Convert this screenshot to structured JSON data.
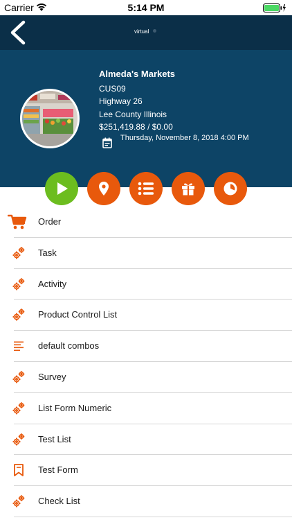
{
  "status_bar": {
    "carrier": "Carrier",
    "time": "5:14 PM"
  },
  "nav": {
    "virtual_label": "virtual"
  },
  "customer": {
    "name": "Almeda's Markets",
    "code": "CUS09",
    "address": "Highway 26",
    "region": "Lee County Illinois",
    "balance": "$251,419.88 / $0.00",
    "date": "Thursday, November 8, 2018 4:00 PM"
  },
  "actions": [
    {
      "icon": "play-icon",
      "color": "#6cbd1f"
    },
    {
      "icon": "location-pin-icon",
      "color": "#e8590c"
    },
    {
      "icon": "list-icon",
      "color": "#e8590c"
    },
    {
      "icon": "gift-icon",
      "color": "#e8590c"
    },
    {
      "icon": "pie-chart-icon",
      "color": "#e8590c"
    }
  ],
  "menu": [
    {
      "label": "Order",
      "icon": "cart-icon"
    },
    {
      "label": "Task",
      "icon": "gears-icon"
    },
    {
      "label": "Activity",
      "icon": "gears-icon"
    },
    {
      "label": "Product Control List",
      "icon": "gears-icon"
    },
    {
      "label": "default combos",
      "icon": "text-lines-icon"
    },
    {
      "label": "Survey",
      "icon": "gears-icon"
    },
    {
      "label": "List Form Numeric",
      "icon": "gears-icon"
    },
    {
      "label": "Test List",
      "icon": "gears-icon"
    },
    {
      "label": "Test Form",
      "icon": "bookmark-icon"
    },
    {
      "label": "Check List",
      "icon": "gears-icon"
    }
  ],
  "colors": {
    "accent": "#e8590c",
    "nav": "#0b2f48",
    "header": "#0d4466",
    "play": "#6cbd1f"
  }
}
